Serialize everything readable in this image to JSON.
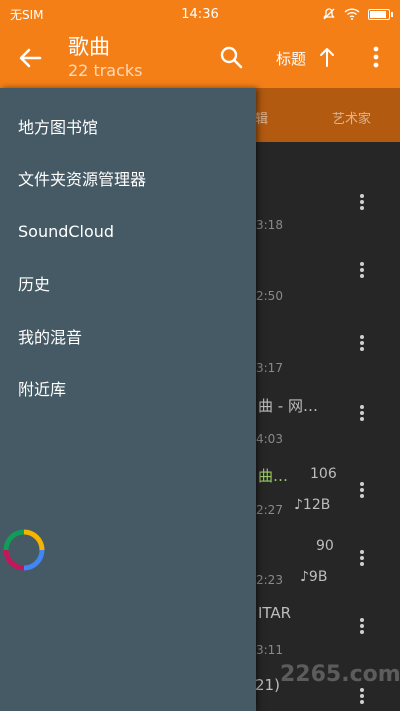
{
  "status": {
    "carrier": "无SIM",
    "time": "14:36"
  },
  "toolbar": {
    "title": "歌曲",
    "subtitle": "22 tracks",
    "sort_label": "标题"
  },
  "tabs": {
    "album": "辑",
    "artist": "艺术家"
  },
  "drawer": {
    "items": [
      {
        "label": "地方图书馆"
      },
      {
        "label": "文件夹资源管理器"
      },
      {
        "label": "SoundCloud"
      },
      {
        "label": "历史"
      },
      {
        "label": "我的混音"
      },
      {
        "label": "附近库"
      }
    ]
  },
  "tracks": [
    {
      "title": "",
      "duration": "3:18"
    },
    {
      "title": "",
      "duration": "2:50"
    },
    {
      "title": "",
      "duration": "3:17"
    },
    {
      "title": "曲 - 网…",
      "duration": "4:03"
    },
    {
      "title": "曲…",
      "duration": "2:27",
      "plays": "106",
      "size": "♪12B"
    },
    {
      "title": "",
      "duration": "2:23",
      "plays": "90",
      "size": "♪9B"
    },
    {
      "title": "ITAR",
      "duration": "3:11"
    },
    {
      "title": "21)",
      "duration": ""
    }
  ],
  "watermark": "2265.com",
  "colors": {
    "accent": "#f57f17",
    "drawer": "#455a64"
  }
}
